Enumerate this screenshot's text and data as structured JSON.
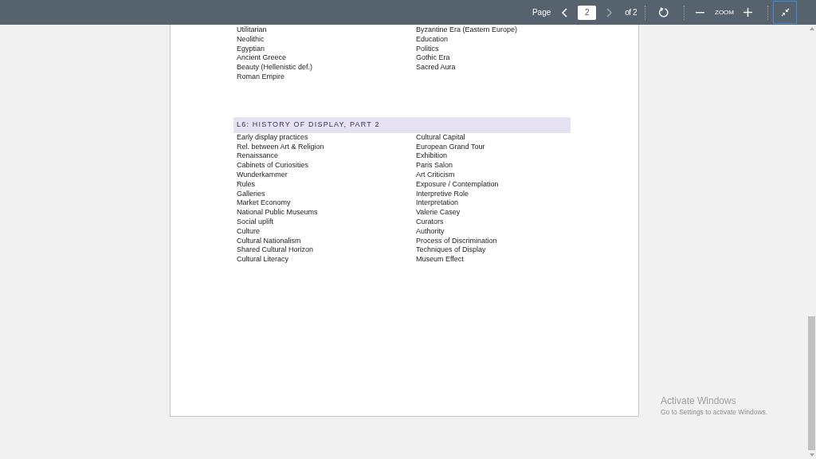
{
  "toolbar": {
    "page_label": "Page",
    "page_value": "2",
    "page_total": "of 2",
    "zoom_label": "ZOOM",
    "nav": [
      {
        "kind": "prev",
        "disabled": false
      },
      {
        "kind": "next",
        "disabled": true
      }
    ],
    "fit_button": {
      "active": true
    }
  },
  "sections": [
    {
      "left": [
        "Utilitarian",
        "Neolithic",
        "Egyptian",
        "Ancient Greece",
        "Beauty (Hellenistic def.)",
        "Roman Empire"
      ],
      "right": [
        "Byzantine Era (Eastern Europe)",
        "Education",
        "Politics",
        "Gothic Era",
        "Sacred Aura"
      ]
    },
    {
      "title": "L6: HISTORY OF DISPLAY, PART 2",
      "left": [
        "Early display practices",
        "Rel. between Art & Religion",
        "Renaissance",
        "Cabinets of Curiosities",
        "Wunderkammer",
        "Rules",
        "Galleries",
        "Market Economy",
        "National Public Museums",
        "Social uplift",
        "Culture",
        "Cultural Nationalism",
        "Shared Cultural Horizon",
        "Cultural Literacy"
      ],
      "right": [
        "Cultural Capital",
        "European Grand Tour",
        "Exhibition",
        "Paris Salon",
        "Art Criticism",
        "Exposure / Contemplation",
        "Interpretive Role",
        "Interpretation",
        "Valerie Casey",
        "Curators",
        "Authority",
        "Process of Discrimination",
        "Techniques of Display",
        "Museum Effect"
      ]
    }
  ],
  "os_notice": {
    "title": "Activate Windows",
    "subtitle": "Go to Settings to activate Windows."
  }
}
